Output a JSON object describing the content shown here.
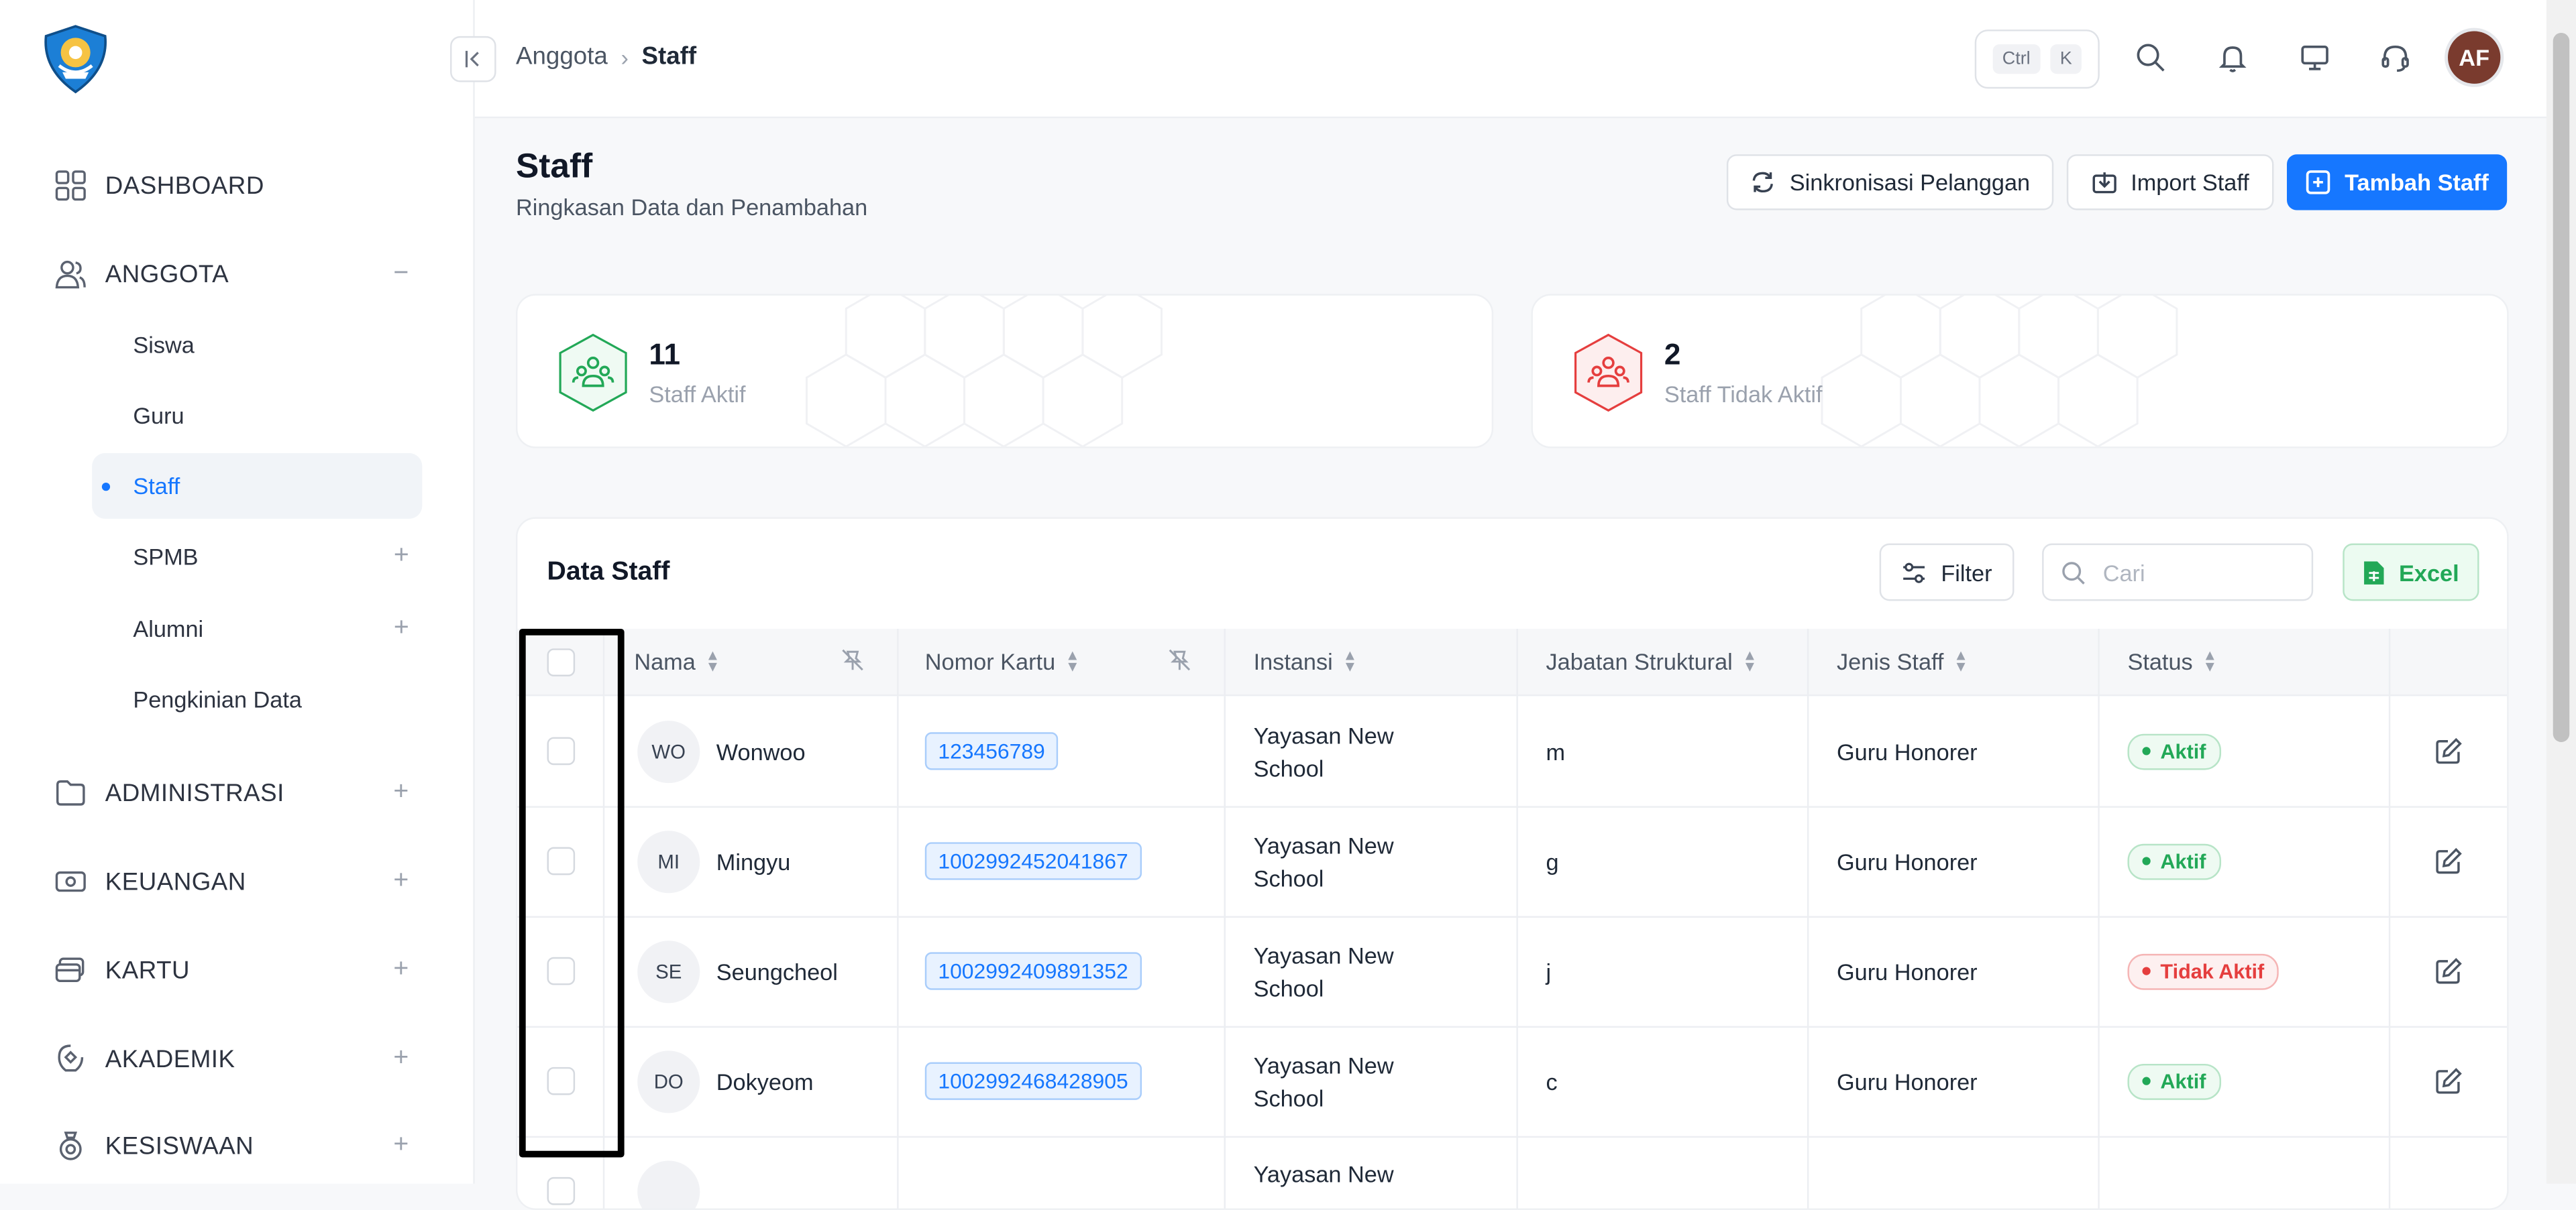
{
  "sidebar": {
    "items": [
      {
        "label": "DASHBOARD",
        "icon": "grid-icon"
      },
      {
        "label": "ANGGOTA",
        "icon": "users-icon",
        "toggle": "−"
      },
      {
        "label": "ADMINISTRASI",
        "icon": "folder-icon",
        "toggle": "+"
      },
      {
        "label": "KEUANGAN",
        "icon": "money-icon",
        "toggle": "+"
      },
      {
        "label": "KARTU",
        "icon": "card-icon",
        "toggle": "+"
      },
      {
        "label": "AKADEMIK",
        "icon": "academic-icon",
        "toggle": "+"
      },
      {
        "label": "KESISWAAN",
        "icon": "student-badge-icon",
        "toggle": "+"
      }
    ],
    "anggota_sub": [
      {
        "label": "Siswa"
      },
      {
        "label": "Guru"
      },
      {
        "label": "Staff"
      },
      {
        "label": "SPMB",
        "toggle": "+"
      },
      {
        "label": "Alumni",
        "toggle": "+"
      },
      {
        "label": "Pengkinian Data"
      }
    ]
  },
  "header": {
    "breadcrumb": [
      "Anggota",
      "Staff"
    ],
    "breadcrumb_sep": "›",
    "shortcut": [
      "Ctrl",
      "K"
    ],
    "avatar": "AF"
  },
  "page": {
    "title": "Staff",
    "subtitle": "Ringkasan Data dan Penambahan",
    "buttons": {
      "sync": "Sinkronisasi Pelanggan",
      "import": "Import Staff",
      "add": "Tambah Staff"
    }
  },
  "stats": [
    {
      "value": "11",
      "label": "Staff Aktif",
      "color": "#22a857"
    },
    {
      "value": "2",
      "label": "Staff Tidak Aktif",
      "color": "#e53e3e"
    }
  ],
  "table": {
    "title": "Data Staff",
    "filter_label": "Filter",
    "search_placeholder": "Cari",
    "excel_label": "Excel",
    "columns": [
      "Nama",
      "Nomor Kartu",
      "Instansi",
      "Jabatan Struktural",
      "Jenis Staff",
      "Status"
    ],
    "rows": [
      {
        "initials": "WO",
        "name": "Wonwoo",
        "card": "123456789",
        "inst1": "Yayasan New",
        "inst2": "School",
        "jabatan": "m",
        "jenis": "Guru Honorer",
        "status": "Aktif"
      },
      {
        "initials": "MI",
        "name": "Mingyu",
        "card": "1002992452041867",
        "inst1": "Yayasan New",
        "inst2": "School",
        "jabatan": "g",
        "jenis": "Guru Honorer",
        "status": "Aktif"
      },
      {
        "initials": "SE",
        "name": "Seungcheol",
        "card": "1002992409891352",
        "inst1": "Yayasan New",
        "inst2": "School",
        "jabatan": "j",
        "jenis": "Guru Honorer",
        "status": "Tidak Aktif"
      },
      {
        "initials": "DO",
        "name": "Dokyeom",
        "card": "1002992468428905",
        "inst1": "Yayasan New",
        "inst2": "School",
        "jabatan": "c",
        "jenis": "Guru Honorer",
        "status": "Aktif"
      },
      {
        "initials": "",
        "name": "",
        "card": "",
        "inst1": "Yayasan New",
        "inst2": "",
        "jabatan": "",
        "jenis": "",
        "status": ""
      }
    ]
  },
  "colors": {
    "accent": "#1677ff",
    "active": "#22a857",
    "inactive": "#e53e3e"
  }
}
